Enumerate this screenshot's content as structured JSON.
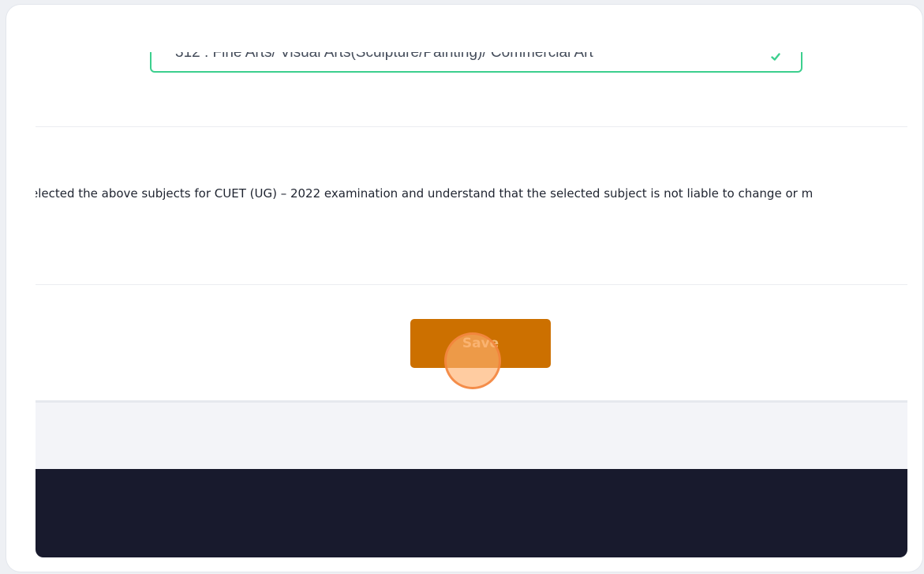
{
  "subject_select": {
    "value": "312 : Fine Arts/ Visual Arts(Sculpture/Painting)/ Commercial Art",
    "check_icon": "check-icon",
    "border_color": "#3ccf8e"
  },
  "declaration": {
    "text": "elected the above subjects for CUET (UG) – 2022 examination and understand that the selected subject is not liable to change or m"
  },
  "actions": {
    "save_label": "Save",
    "save_color": "#cc7000"
  },
  "footer": {
    "color": "#181a2d"
  }
}
